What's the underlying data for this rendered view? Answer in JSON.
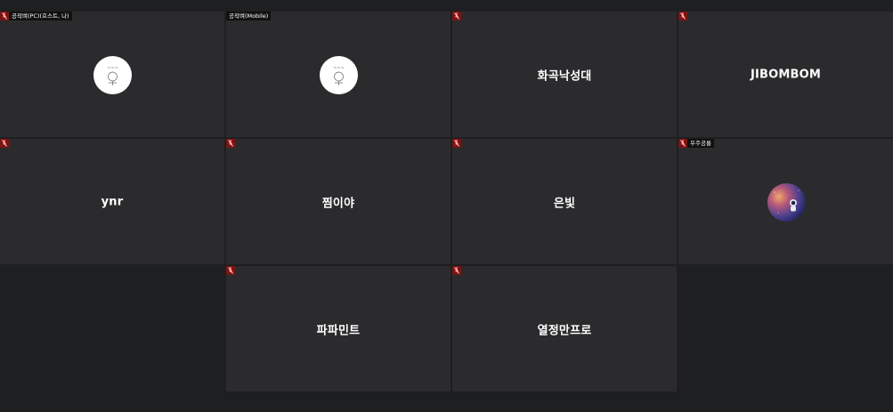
{
  "participants": [
    {
      "id": "p1",
      "display_name": "",
      "tag_label": "공작벼(PC)(호스트, 나)",
      "avatar": "doodle-sketch",
      "muted": true
    },
    {
      "id": "p2",
      "display_name": "",
      "tag_label": "공작벼(Mobile)",
      "avatar": "doodle-sketch",
      "muted": true
    },
    {
      "id": "p3",
      "display_name": "화곡낙성대",
      "tag_label": "",
      "avatar": "",
      "muted": true
    },
    {
      "id": "p4",
      "display_name": "JIBOMBOM",
      "tag_label": "",
      "avatar": "",
      "muted": true
    },
    {
      "id": "p5",
      "display_name": "ynr",
      "tag_label": "",
      "avatar": "",
      "muted": true
    },
    {
      "id": "p6",
      "display_name": "찜이야",
      "tag_label": "",
      "avatar": "",
      "muted": true
    },
    {
      "id": "p7",
      "display_name": "은빛",
      "tag_label": "",
      "avatar": "",
      "muted": true
    },
    {
      "id": "p8",
      "display_name": "",
      "tag_label": "우주공룡",
      "avatar": "astronaut-space",
      "muted": true
    },
    {
      "id": "p9",
      "display_name": "파파민트",
      "tag_label": "",
      "avatar": "",
      "muted": true
    },
    {
      "id": "p10",
      "display_name": "열정만프로",
      "tag_label": "",
      "avatar": "",
      "muted": true
    }
  ],
  "colors": {
    "background": "#1e1f20",
    "tile": "#2b2b2d",
    "muted_indicator": "#7a1414",
    "name_text": "#ffffff"
  },
  "icons": {
    "muted": "mic-muted-icon"
  }
}
